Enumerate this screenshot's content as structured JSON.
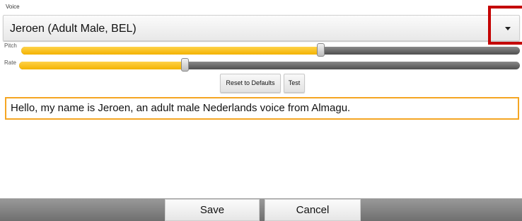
{
  "voice": {
    "label": "Voice",
    "selected": "Jeroen (Adult Male, BEL)"
  },
  "sliders": {
    "pitch": {
      "label": "Pitch",
      "level": 0.6
    },
    "rate": {
      "label": "Rate",
      "level": 0.33
    }
  },
  "buttons": {
    "reset_label": "Reset to Defaults",
    "test_label": "Test",
    "save_label": "Save",
    "cancel_label": "Cancel"
  },
  "sample_text": "Hello, my name is Jeroen, an adult male Nederlands voice from Almagu.",
  "colors": {
    "accent": "#F3B300",
    "highlight": "#C40000",
    "input_border": "#F5A623"
  },
  "icons": {
    "dropdown": "chevron-down-icon"
  }
}
